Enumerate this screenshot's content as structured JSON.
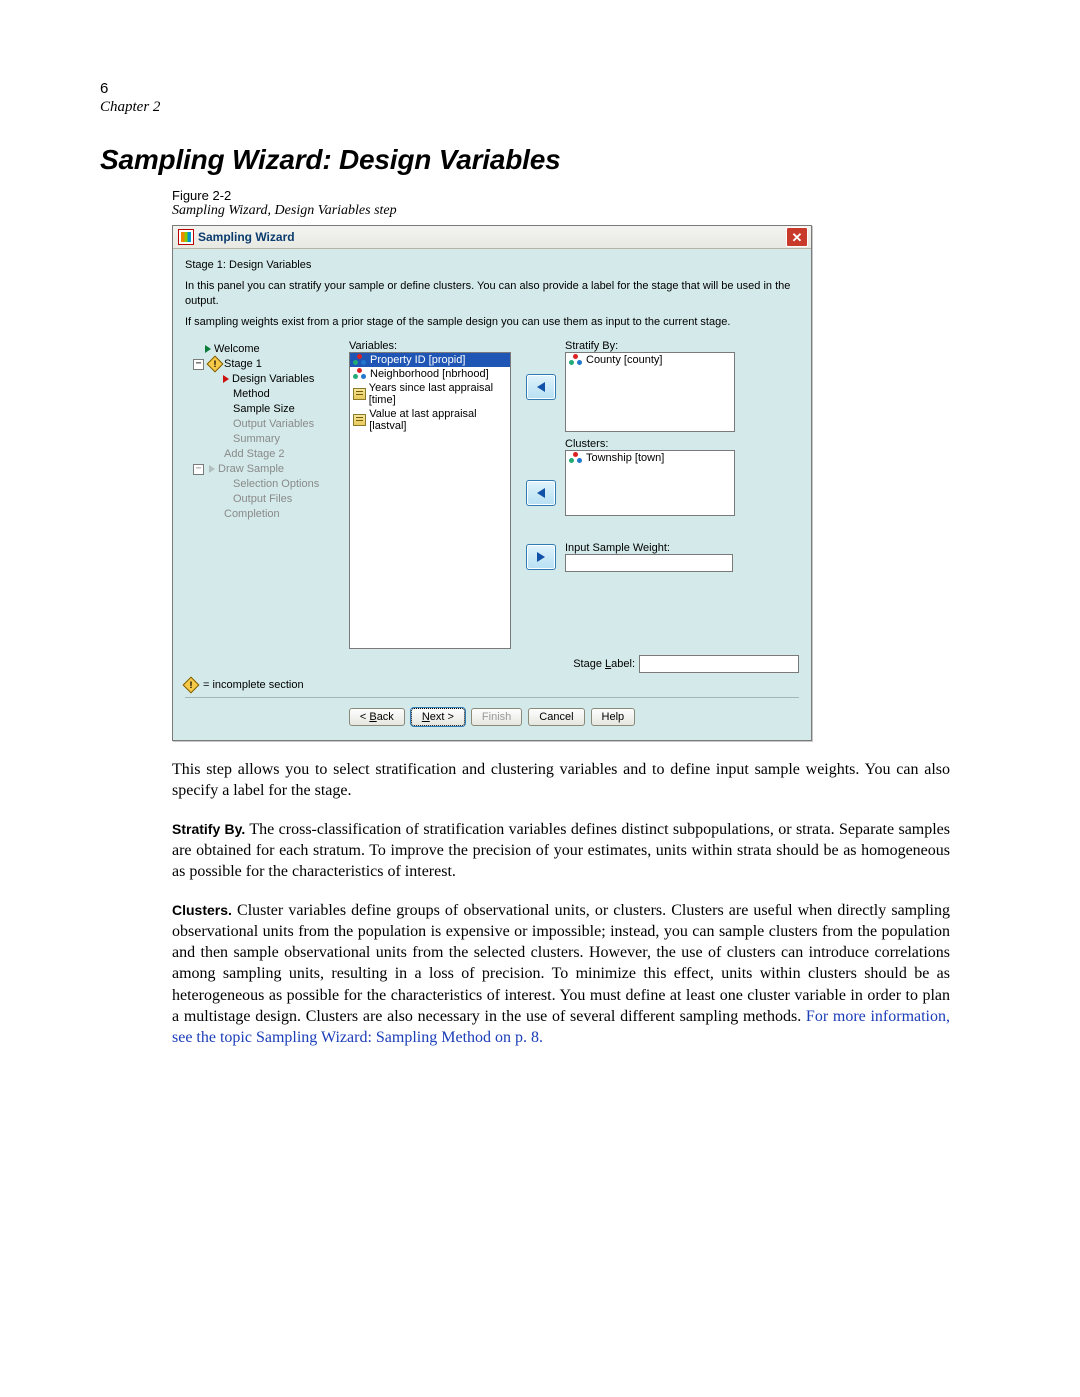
{
  "page_number": "6",
  "chapter": "Chapter 2",
  "heading": "Sampling Wizard: Design Variables",
  "figure_label": "Figure 2-2",
  "figure_caption": "Sampling Wizard, Design Variables step",
  "dialog": {
    "title": "Sampling Wizard",
    "close_x": "✕",
    "stage_title": "Stage 1: Design Variables",
    "intro1": "In this panel you can stratify your sample or define clusters. You can also provide a label for the stage that will be used in the output.",
    "intro2": "If sampling weights exist from a prior stage of the sample design you can use them as input to the current stage.",
    "tree": {
      "welcome": "Welcome",
      "stage1": "Stage 1",
      "design_variables": "Design Variables",
      "method": "Method",
      "sample_size": "Sample Size",
      "output_variables": "Output Variables",
      "summary": "Summary",
      "add_stage2": "Add Stage 2",
      "draw_sample": "Draw Sample",
      "selection_options": "Selection Options",
      "output_files": "Output Files",
      "completion": "Completion"
    },
    "variables_label": "Variables:",
    "variables": {
      "v1": "Property ID [propid]",
      "v2": "Neighborhood [nbrhood]",
      "v3": "Years since last appraisal [time]",
      "v4": "Value at last appraisal [lastval]"
    },
    "stratify_label": "Stratify By:",
    "stratify_item": "County [county]",
    "clusters_label": "Clusters:",
    "clusters_item": "Township [town]",
    "input_weight_label": "Input Sample Weight:",
    "stage_label_label_prefix": "Stage ",
    "stage_label_label_letter": "L",
    "stage_label_label_suffix": "abel:",
    "incomplete_note": "= incomplete section",
    "buttons": {
      "back_prefix": "< ",
      "back_letter": "B",
      "back_suffix": "ack",
      "next_letter": "N",
      "next_suffix": "ext >",
      "finish": "Finish",
      "cancel": "Cancel",
      "help": "Help"
    }
  },
  "body": {
    "p1": "This step allows you to select stratification and clustering variables and to define input sample weights. You can also specify a label for the stage.",
    "p2_label": "Stratify By.",
    "p2": " The cross-classification of stratification variables defines distinct subpopulations, or strata. Separate samples are obtained for each stratum. To improve the precision of your estimates, units within strata should be as homogeneous as possible for the characteristics of interest.",
    "p3_label": "Clusters.",
    "p3a": " Cluster variables define groups of observational units, or clusters. Clusters are useful when directly sampling observational units from the population is expensive or impossible; instead, you can sample clusters from the population and then sample observational units from the selected clusters. However, the use of clusters can introduce correlations among sampling units, resulting in a loss of precision. To minimize this effect, units within clusters should be as heterogeneous as possible for the characteristics of interest. You must define at least one cluster variable in order to plan a multistage design. Clusters are also necessary in the use of several different sampling methods. ",
    "p3_link": "For more information, see the topic Sampling Wizard: Sampling Method on p. 8."
  }
}
